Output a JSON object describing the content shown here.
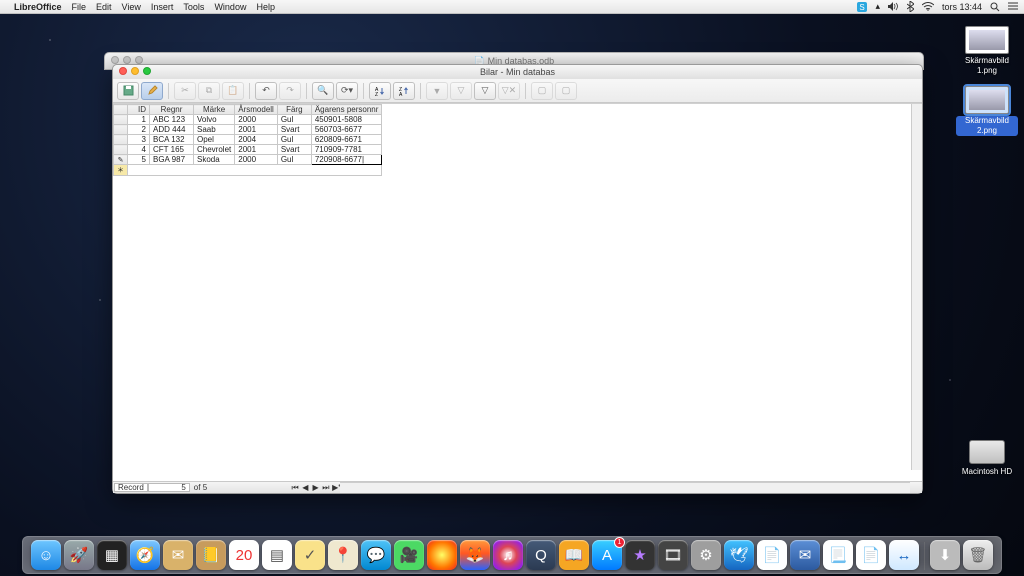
{
  "menubar": {
    "appname": "LibreOffice",
    "items": [
      "File",
      "Edit",
      "View",
      "Insert",
      "Tools",
      "Window",
      "Help"
    ],
    "clock": "tors 13:44"
  },
  "desktop": {
    "screenshot1": "Skärmavbild 1.png",
    "screenshot2": "Skärmavbild 2.png",
    "hd": "Macintosh HD"
  },
  "background_window_title": "Min databas.odb",
  "window": {
    "title": "Bilar - Min databas",
    "columns": [
      "ID",
      "Regnr",
      "Märke",
      "Årsmodell",
      "Färg",
      "Ägarens personnr"
    ],
    "rows": [
      {
        "id": "1",
        "reg": "ABC 123",
        "marke": "Volvo",
        "ar": "2000",
        "farg": "Gul",
        "pn": "450901-5808"
      },
      {
        "id": "2",
        "reg": "ADD 444",
        "marke": "Saab",
        "ar": "2001",
        "farg": "Svart",
        "pn": "560703-6677"
      },
      {
        "id": "3",
        "reg": "BCA 132",
        "marke": "Opel",
        "ar": "2004",
        "farg": "Gul",
        "pn": "620809-6671"
      },
      {
        "id": "4",
        "reg": "CFT 165",
        "marke": "Chevrolet",
        "ar": "2001",
        "farg": "Svart",
        "pn": "710909-7781"
      },
      {
        "id": "5",
        "reg": "BGA 987",
        "marke": "Skoda",
        "ar": "2000",
        "farg": "Gul",
        "pn": "720908-6677"
      }
    ],
    "status": {
      "record_label": "Record",
      "record_current": "5",
      "record_of": "of 5"
    }
  },
  "dock_labels": [
    "Finder",
    "Launchpad",
    "Mission Control",
    "Safari",
    "Mail",
    "Contacts",
    "Calendar",
    "Notes",
    "Reminders",
    "Maps",
    "Messages",
    "FaceTime",
    "Photo Booth",
    "Firefox",
    "iTunes",
    "QuickTime",
    "iBooks",
    "App Store",
    "iMovie",
    "Preview",
    "System Preferences",
    "OpenOffice",
    "TextEdit",
    "Thunderbird",
    "Pages",
    "LibreOffice",
    "TeamViewer",
    "Downloads",
    "Trash"
  ],
  "appstore_badge": "1"
}
